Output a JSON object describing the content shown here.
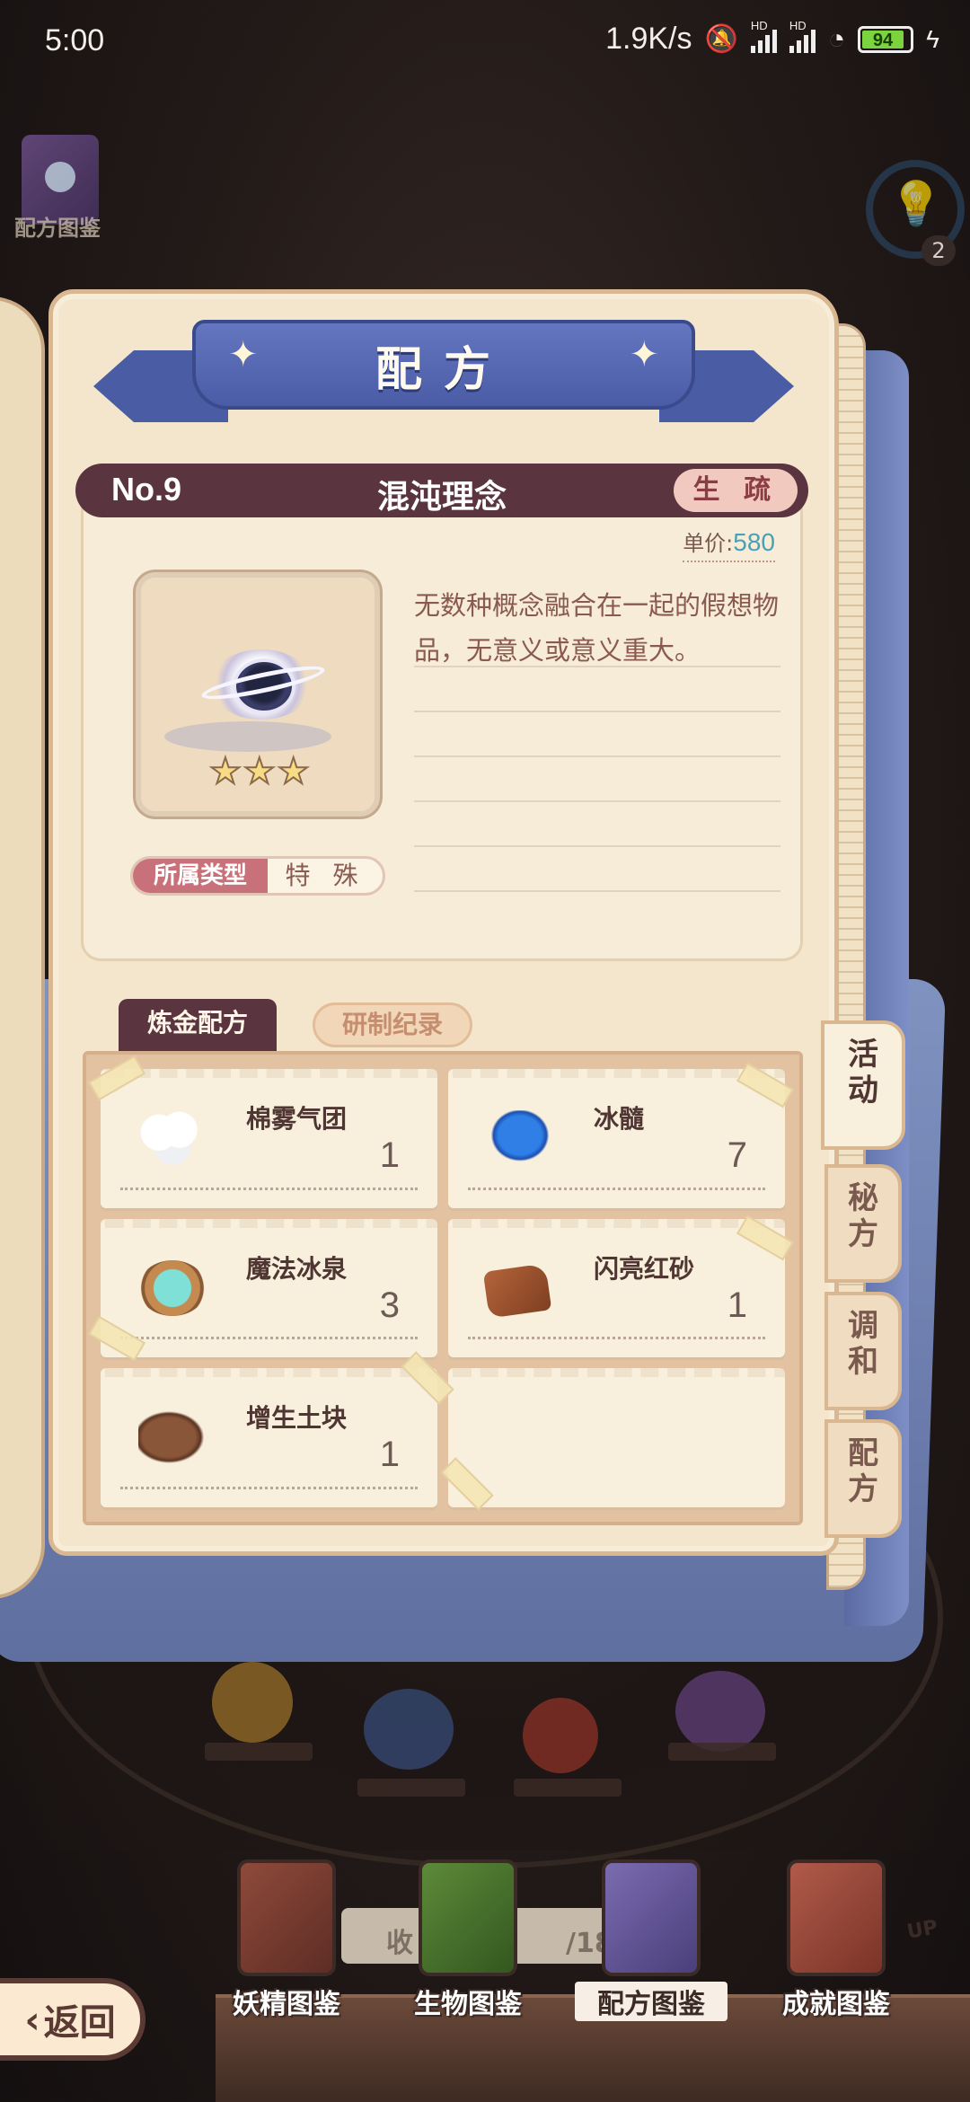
{
  "status": {
    "time": "5:00",
    "net_speed": "1.9K/s",
    "hd1": "HD",
    "hd2": "HD",
    "battery": "94"
  },
  "corner": {
    "label": "配方图鉴",
    "hint_count": "2"
  },
  "book": {
    "banner_title": "配方",
    "recipe_no": "No.9",
    "recipe_name": "混沌理念",
    "familiarity": "生 疏",
    "price_label": "单价:",
    "price_value": "580",
    "stars": 3,
    "type_label": "所属类型",
    "type_value": "特 殊",
    "description": "无数种概念融合在一起的假想物品，无意义或意义重大。"
  },
  "tabs": {
    "active": "炼金配方",
    "inactive": "研制纪录"
  },
  "ingredients": [
    {
      "name": "棉雾气团",
      "qty": "1",
      "icon": "cotton-cloud-icon"
    },
    {
      "name": "冰髓",
      "qty": "7",
      "icon": "ice-marrow-icon"
    },
    {
      "name": "魔法冰泉",
      "qty": "3",
      "icon": "magic-spring-icon"
    },
    {
      "name": "闪亮红砂",
      "qty": "1",
      "icon": "red-sand-icon"
    },
    {
      "name": "增生土块",
      "qty": "1",
      "icon": "soil-clod-icon"
    }
  ],
  "side_tabs": [
    "活动",
    "秘方",
    "调和",
    "配方"
  ],
  "bottom_nav": {
    "items": [
      "妖精图鉴",
      "生物图鉴",
      "配方图鉴",
      "成就图鉴"
    ],
    "progress_text": "收",
    "progress_count": "/186",
    "up_badge": "UP",
    "back": "返回"
  },
  "colors": {
    "banner": "#4b5ca6",
    "title_bar": "#5a3540",
    "price": "#4aa0b4",
    "type_label": "#c9717a"
  }
}
